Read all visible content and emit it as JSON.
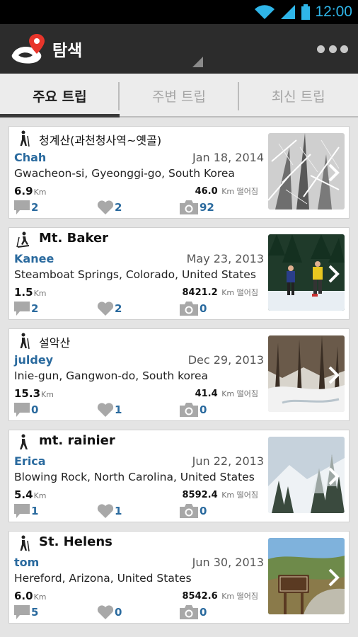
{
  "status": {
    "time": "12:00"
  },
  "header": {
    "title": "탐색"
  },
  "tabs": [
    {
      "label": "주요 트립",
      "active": true
    },
    {
      "label": "주변 트립",
      "active": false
    },
    {
      "label": "최신 트립",
      "active": false
    }
  ],
  "trips": [
    {
      "title": "청계산(과천청사역~옛골)",
      "activity": "hiking-icon",
      "user": "Chah",
      "date": "Jan 18, 2014",
      "location": "Gwacheon-si, Gyeonggi-go, South Korea",
      "distance": "6.9",
      "distance_unit": "Km",
      "away": "46.0",
      "away_unit": "Km 떨어짐",
      "comments": "2",
      "likes": "2",
      "photos": "92"
    },
    {
      "title": "Mt. Baker",
      "activity": "snowshoe-icon",
      "user": "Kanee",
      "date": "May 23, 2013",
      "location": "Steamboat Springs, Colorado, United States",
      "distance": "1.5",
      "distance_unit": "Km",
      "away": "8421.2",
      "away_unit": "Km 떨어짐",
      "comments": "2",
      "likes": "2",
      "photos": "0"
    },
    {
      "title": "설악산",
      "activity": "hiking-icon",
      "user": "juldey",
      "date": "Dec 29, 2013",
      "location": "Inie-gun, Gangwon-do, South korea",
      "distance": "15.3",
      "distance_unit": "Km",
      "away": "41.4",
      "away_unit": "Km 떨어짐",
      "comments": "0",
      "likes": "1",
      "photos": "0"
    },
    {
      "title": "mt. rainier",
      "activity": "walking-icon",
      "user": "Erica",
      "date": "Jun 22, 2013",
      "location": "Blowing Rock, North Carolina, United States",
      "distance": "5.4",
      "distance_unit": "Km",
      "away": "8592.4",
      "away_unit": "Km 떨어짐",
      "comments": "1",
      "likes": "1",
      "photos": "0"
    },
    {
      "title": "St. Helens",
      "activity": "hiking-icon",
      "user": "tom",
      "date": "Jun 30, 2013",
      "location": "Hereford, Arizona, United States",
      "distance": "6.0",
      "distance_unit": "Km",
      "away": "8542.6",
      "away_unit": "Km 떨어짐",
      "comments": "5",
      "likes": "0",
      "photos": "0"
    }
  ],
  "colors": {
    "accent": "#2a6a9e",
    "actionbar": "#2c2c2c",
    "status_time": "#2fb5e8",
    "logo_pin": "#e8352b"
  }
}
